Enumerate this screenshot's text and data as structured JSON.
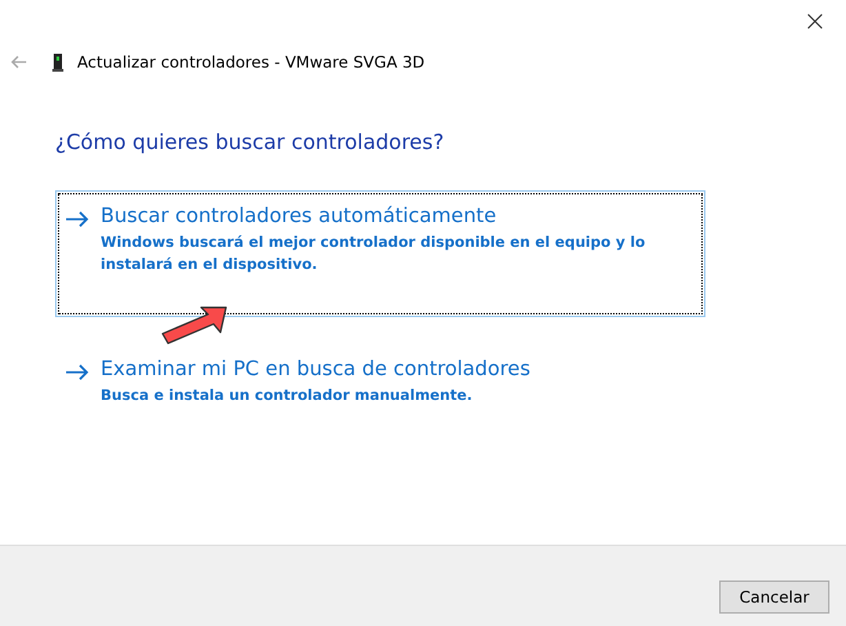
{
  "window": {
    "title": "Actualizar controladores - VMware SVGA 3D"
  },
  "heading": "¿Cómo quieres buscar controladores?",
  "options": [
    {
      "title": "Buscar controladores automáticamente",
      "description": "Windows buscará el mejor controlador disponible en el equipo y lo instalará en el dispositivo.",
      "selected": true
    },
    {
      "title": "Examinar mi PC en busca de controladores",
      "description": "Busca e instala un controlador manualmente.",
      "selected": false
    }
  ],
  "buttons": [
    "Cancelar"
  ]
}
